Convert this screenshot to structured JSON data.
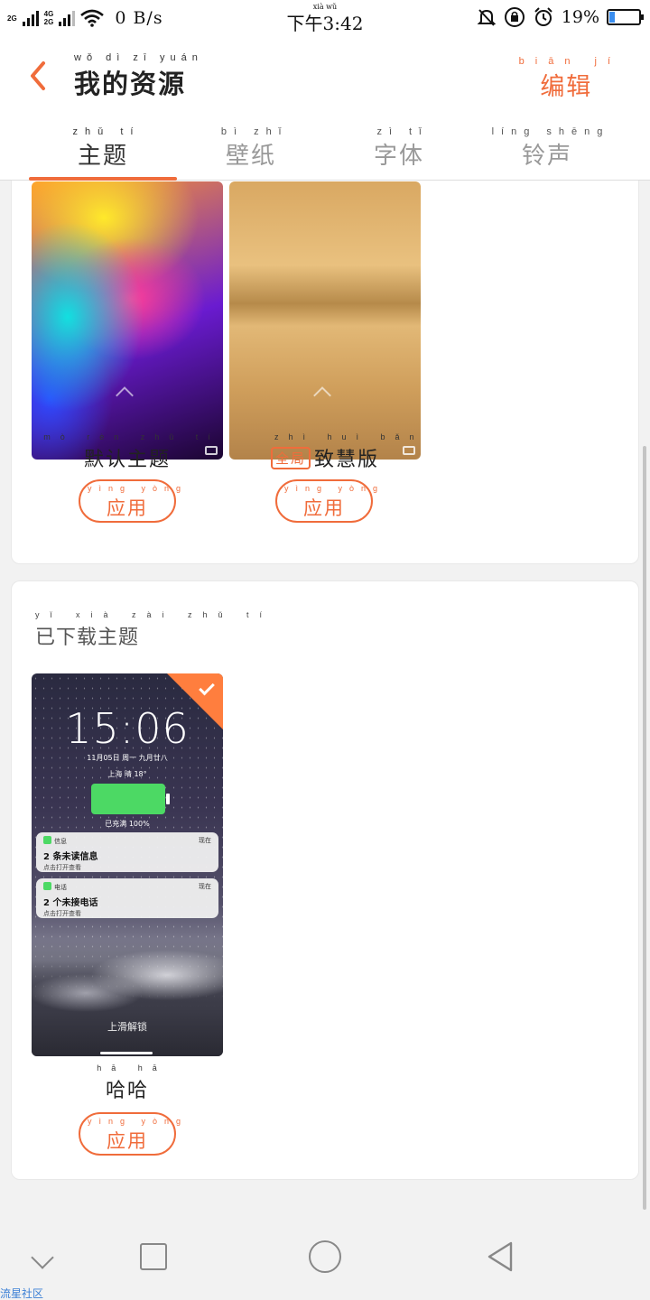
{
  "status_bar": {
    "network_left_top": "2G",
    "network_left_bottom": "",
    "network_right_top": "4G",
    "network_right_bottom": "2G",
    "speed": "0 B/s",
    "time_pinyin": "xià  wǔ",
    "time": "下午3:42",
    "battery_percent": "19%",
    "battery_level": 0.19,
    "icons": [
      "signal-icon",
      "wifi-icon",
      "mute-icon",
      "rotation-lock-icon",
      "alarm-icon",
      "battery-icon"
    ]
  },
  "header": {
    "title_pinyin": "wǒ dì zī yuán",
    "title": "我的资源",
    "edit_pinyin": "biān jí",
    "edit_label": "编辑",
    "accent_color": "#f06c3b"
  },
  "tabs": [
    {
      "pinyin": "zhǔ tí",
      "label": "主题",
      "active": true
    },
    {
      "pinyin": "bì zhǐ",
      "label": "壁纸",
      "active": false
    },
    {
      "pinyin": "zì tǐ",
      "label": "字体",
      "active": false
    },
    {
      "pinyin": "líng shēng",
      "label": "铃声",
      "active": false
    }
  ],
  "preset_themes": [
    {
      "name_pinyin": "mò rèn zhǔ tí",
      "name": "默认主题",
      "badge": "",
      "apply_pinyin": "yìng yòng",
      "apply_label": "应用"
    },
    {
      "name_pinyin": "zhì huì bǎn",
      "name": "致慧版",
      "badge": "全局",
      "apply_pinyin": "yìng yòng",
      "apply_label": "应用"
    }
  ],
  "downloaded": {
    "section_pinyin": "yǐ xià zài zhǔ tí",
    "section_title": "已下载主题",
    "preview": {
      "clock": "15:06",
      "date": "11月05日 周一 九月廿八",
      "weather": "上海  晴  18°",
      "charged": "已充满 100%",
      "notifications": [
        {
          "app": "信息",
          "time": "现在",
          "title": "2 条未读信息",
          "sub": "点击打开查看"
        },
        {
          "app": "电话",
          "time": "现在",
          "title": "2 个未接电话",
          "sub": "点击打开查看"
        }
      ],
      "unlock": "上滑解锁"
    },
    "themes": [
      {
        "name_pinyin": "hā hā",
        "name": "哈哈",
        "apply_pinyin": "yìng yòng",
        "apply_label": "应用",
        "selected": true
      }
    ]
  },
  "nav": {
    "icons": [
      "hide-nav-icon",
      "recents-icon",
      "home-icon",
      "back-icon"
    ]
  },
  "watermark": "流星社区"
}
